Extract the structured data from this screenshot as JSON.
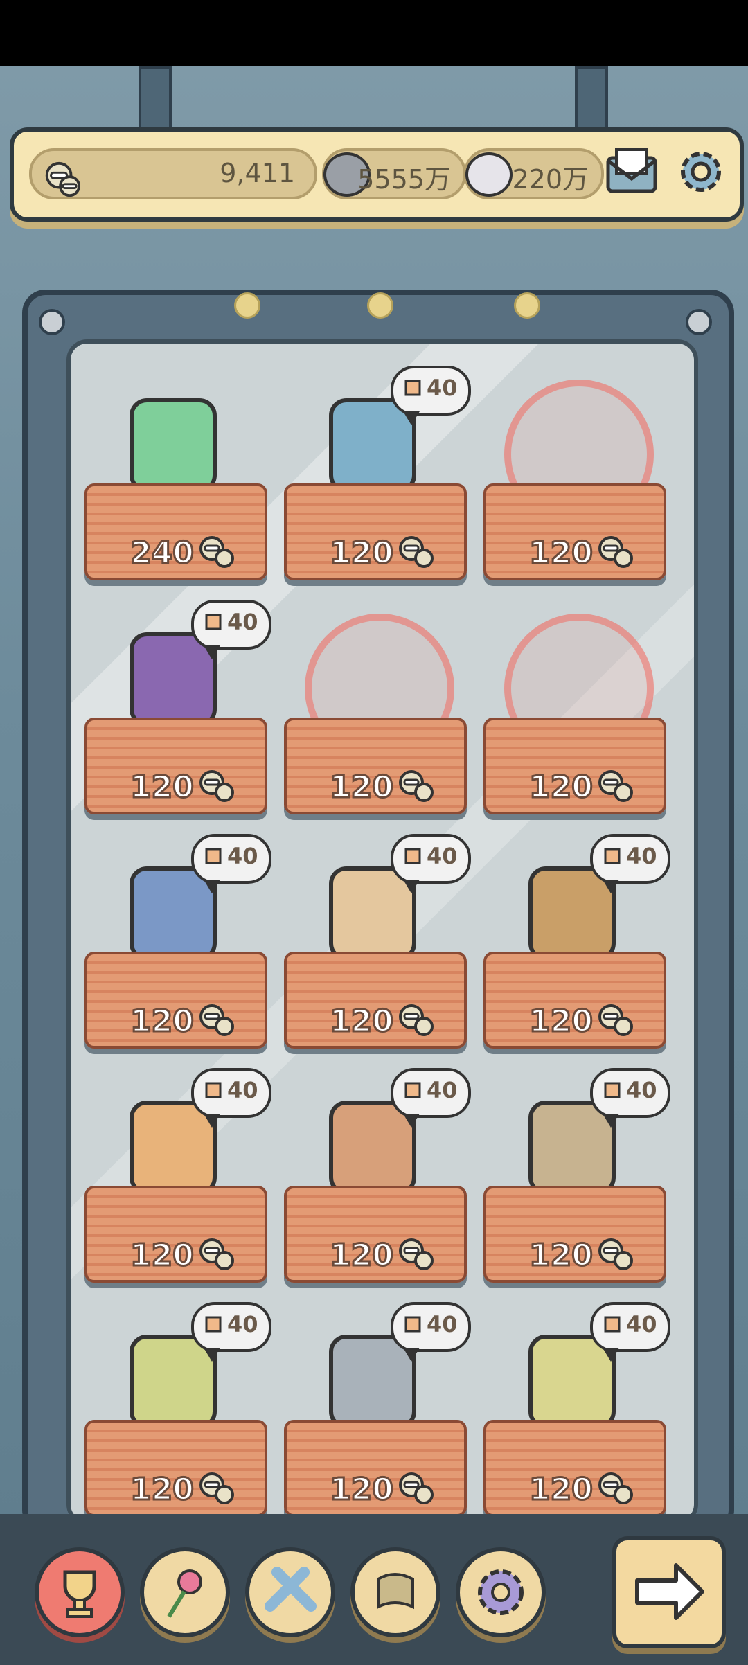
{
  "status_bar": {},
  "header": {
    "coins": "9,411",
    "grey_bubbles": "5555万",
    "white_bubbles": "220万",
    "icons": {
      "coin": "coin-stack-icon",
      "mail": "mail-icon",
      "settings": "gear-icon"
    }
  },
  "shop": {
    "slots": [
      {
        "item": "green-gem-icon",
        "price": "240",
        "tag": "",
        "sealed": false
      },
      {
        "item": "globe-icon",
        "price": "120",
        "tag": "40",
        "sealed": false
      },
      {
        "item": "telescope-sealed-icon",
        "price": "120",
        "tag": "",
        "sealed": true
      },
      {
        "item": "atlas-book-icon",
        "price": "120",
        "tag": "40",
        "sealed": false
      },
      {
        "item": "frame-sealed-icon",
        "price": "120",
        "tag": "",
        "sealed": true
      },
      {
        "item": "machine-sealed-icon",
        "price": "120",
        "tag": "",
        "sealed": true
      },
      {
        "item": "eagle-book-icon",
        "price": "120",
        "tag": "40",
        "sealed": false
      },
      {
        "item": "torch-icon",
        "price": "120",
        "tag": "40",
        "sealed": false
      },
      {
        "item": "vase-icon",
        "price": "120",
        "tag": "40",
        "sealed": false
      },
      {
        "item": "wooden-horse-icon",
        "price": "120",
        "tag": "40",
        "sealed": false
      },
      {
        "item": "brain-icon",
        "price": "120",
        "tag": "40",
        "sealed": false
      },
      {
        "item": "certificate-book-icon",
        "price": "120",
        "tag": "40",
        "sealed": false
      },
      {
        "item": "portrait-book-icon",
        "price": "120",
        "tag": "40",
        "sealed": false
      },
      {
        "item": "warrior-statue-icon",
        "price": "120",
        "tag": "40",
        "sealed": false
      },
      {
        "item": "skeleton-case-icon",
        "price": "120",
        "tag": "40",
        "sealed": false
      }
    ]
  },
  "nav": {
    "buttons": [
      "trophy-icon",
      "rose-icon",
      "cross-icon",
      "scroll-icon",
      "gear-icon"
    ],
    "next": "arrow-right-icon"
  }
}
